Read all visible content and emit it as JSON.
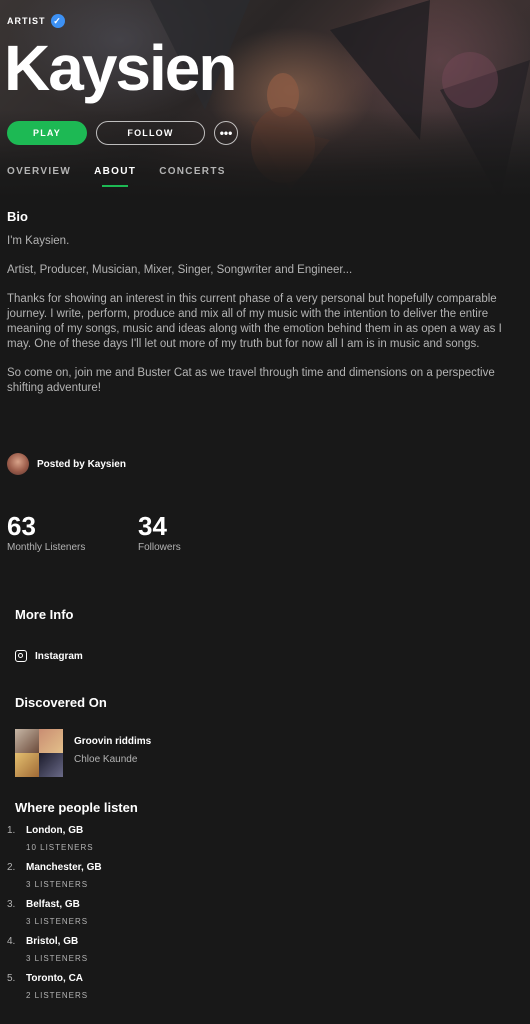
{
  "header": {
    "artist_tag": "ARTIST",
    "artist_name": "Kaysien",
    "play_label": "PLAY",
    "follow_label": "FOLLOW",
    "more_label": "•••"
  },
  "tabs": [
    {
      "label": "OVERVIEW",
      "active": false
    },
    {
      "label": "ABOUT",
      "active": true
    },
    {
      "label": "CONCERTS",
      "active": false
    }
  ],
  "bio": {
    "title": "Bio",
    "paragraphs": [
      "I'm Kaysien.",
      "Artist, Producer, Musician, Mixer, Singer, Songwriter and Engineer...",
      "Thanks for showing an interest in this current phase of a very personal but hopefully comparable journey. I write, perform, produce and mix all of my music with the intention to deliver the entire meaning of my songs, music and ideas along with the emotion behind them in as open a way as I may. One of these days I'll let out more of my truth but for now all I am is in music and songs.",
      "So come on, join me and Buster Cat as we travel through time and dimensions on a perspective shifting adventure!"
    ],
    "posted_by": "Posted by Kaysien"
  },
  "stats": {
    "monthly_listeners": "63",
    "monthly_listeners_label": "Monthly Listeners",
    "followers": "34",
    "followers_label": "Followers"
  },
  "more_info": {
    "title": "More Info",
    "instagram_label": "Instagram"
  },
  "discovered_on": {
    "title": "Discovered On",
    "playlist_name": "Groovin riddims",
    "playlist_owner": "Chloe Kaunde"
  },
  "where_people_listen": {
    "title": "Where people listen",
    "cities": [
      {
        "rank": "1.",
        "name": "London, GB",
        "listeners": "10 LISTENERS"
      },
      {
        "rank": "2.",
        "name": "Manchester, GB",
        "listeners": "3 LISTENERS"
      },
      {
        "rank": "3.",
        "name": "Belfast, GB",
        "listeners": "3 LISTENERS"
      },
      {
        "rank": "4.",
        "name": "Bristol, GB",
        "listeners": "3 LISTENERS"
      },
      {
        "rank": "5.",
        "name": "Toronto, CA",
        "listeners": "2 LISTENERS"
      }
    ]
  },
  "colors": {
    "background": "#181818",
    "accent": "#1db954",
    "verified": "#3d91f4",
    "muted_text": "#b3b3b3"
  },
  "icons": [
    "verified-badge-icon",
    "instagram-icon",
    "more-options-icon"
  ]
}
